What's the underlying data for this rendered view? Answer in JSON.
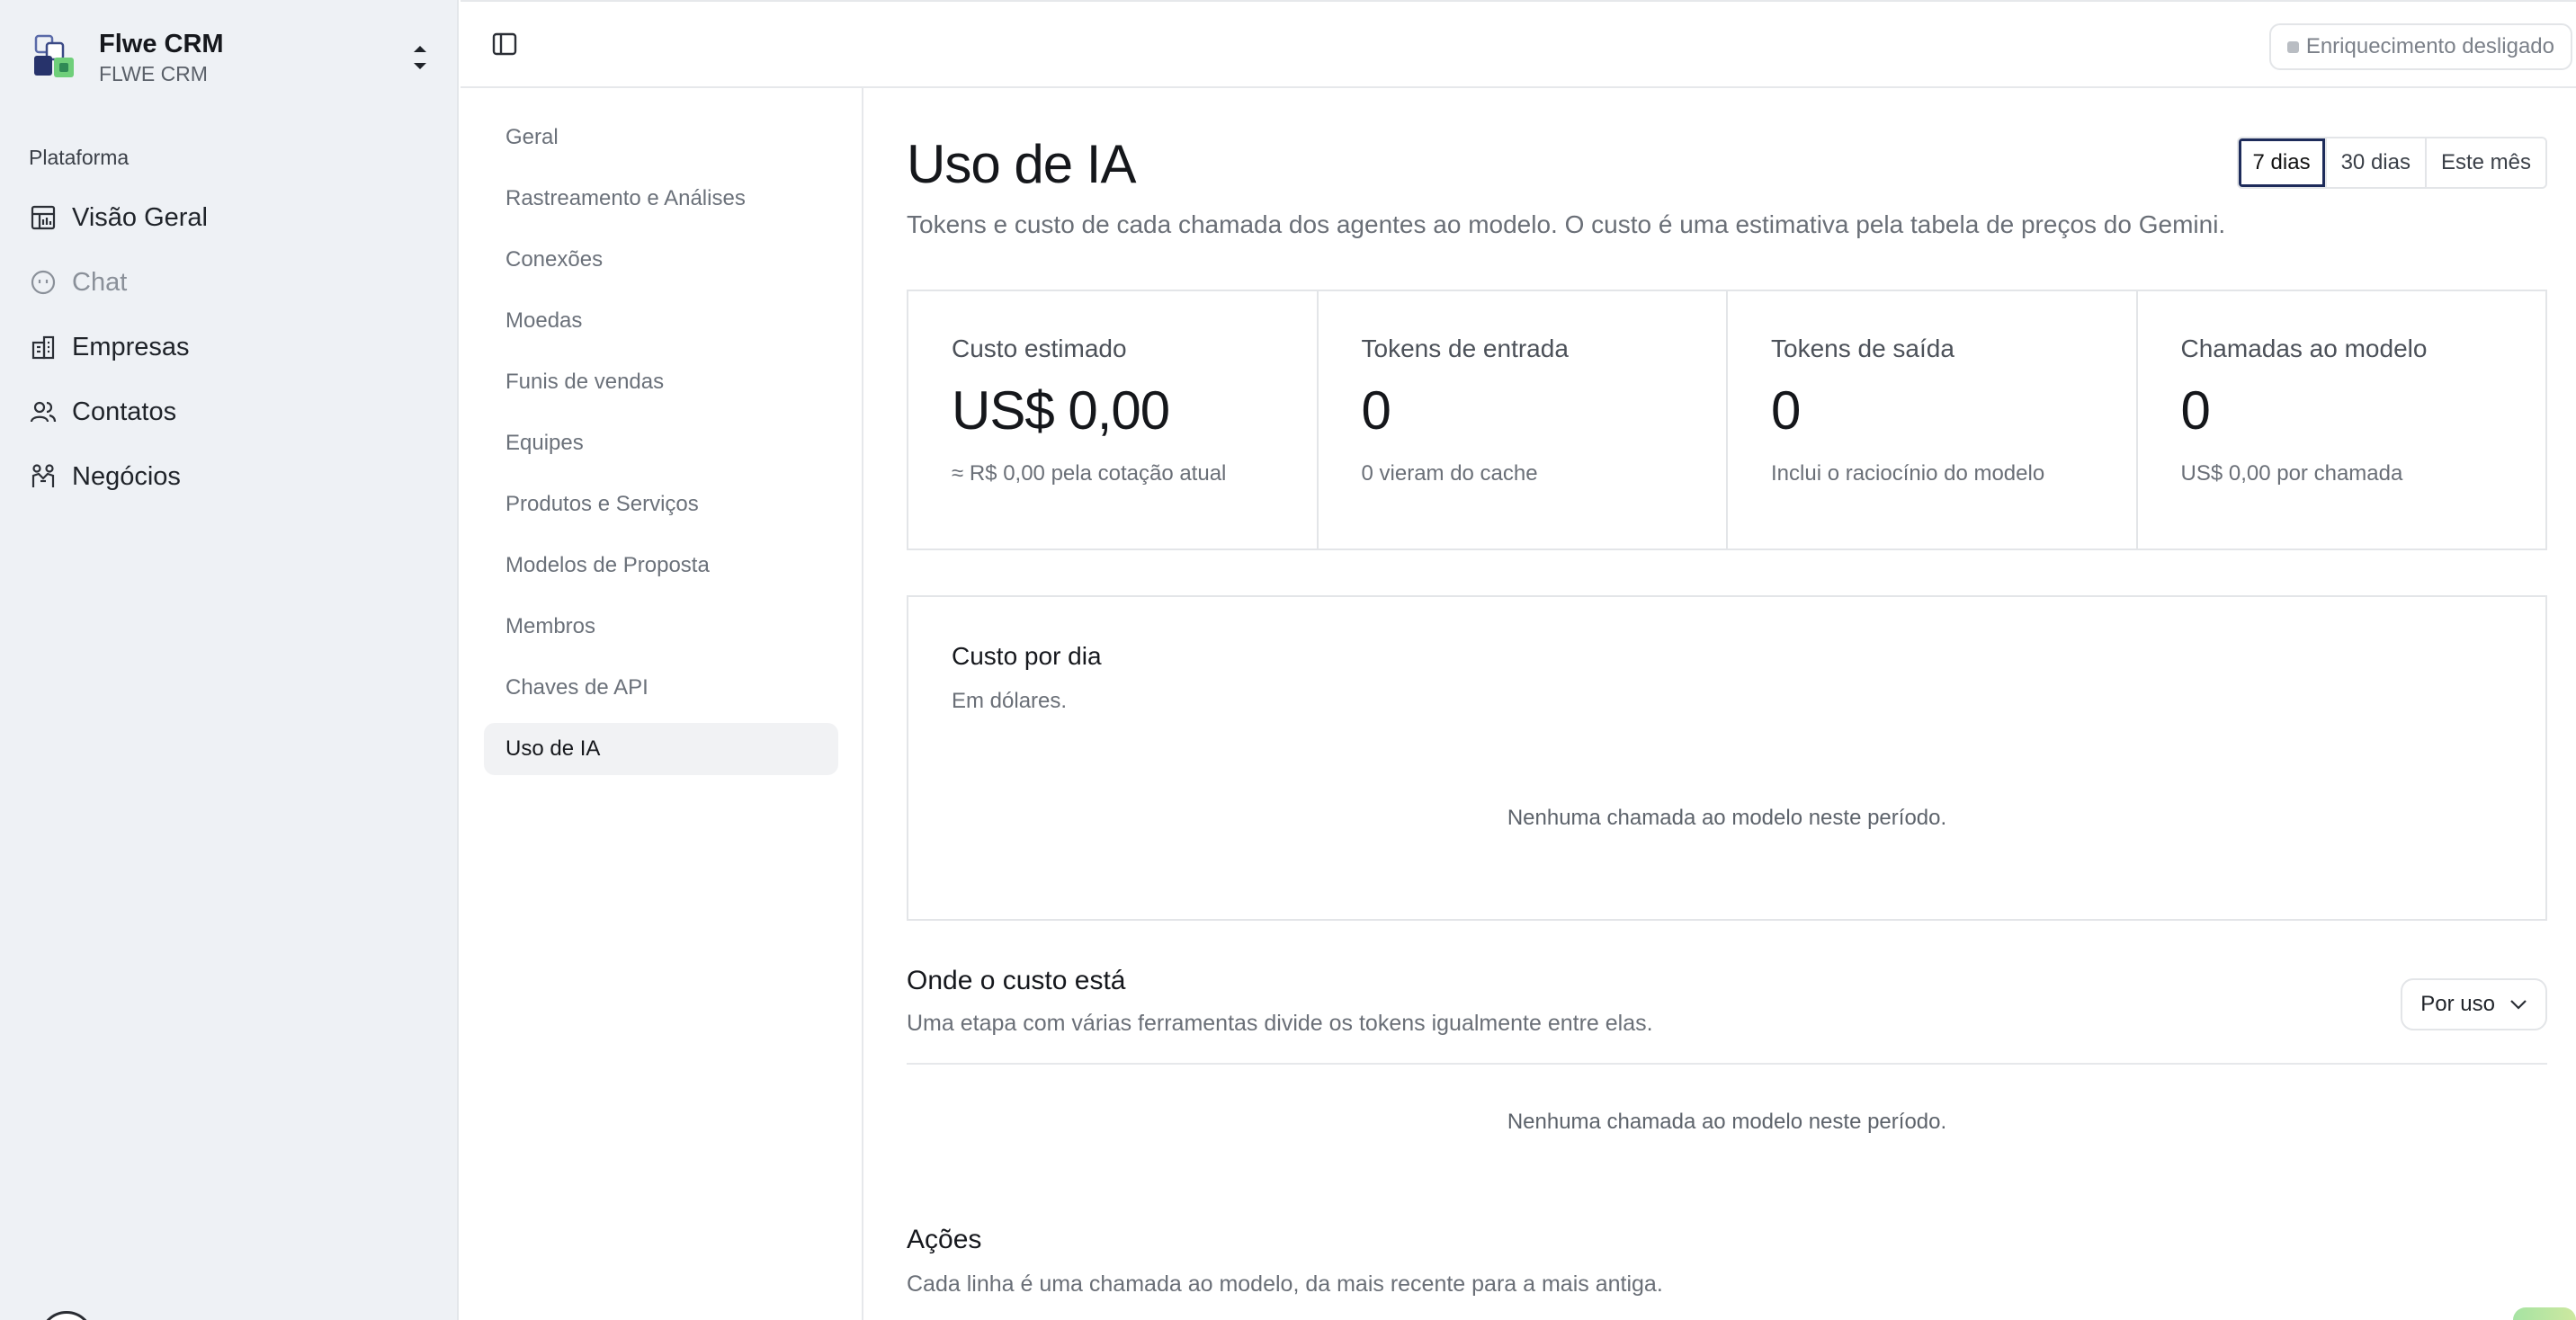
{
  "org": {
    "name": "Flwe CRM",
    "subtitle": "FLWE CRM"
  },
  "sidebar": {
    "section_title": "Plataforma",
    "items": [
      {
        "label": "Visão Geral",
        "icon": "dashboard-icon",
        "disabled": false
      },
      {
        "label": "Chat",
        "icon": "chat-icon",
        "disabled": true
      },
      {
        "label": "Empresas",
        "icon": "building-icon",
        "disabled": false
      },
      {
        "label": "Contatos",
        "icon": "users-icon",
        "disabled": false
      },
      {
        "label": "Negócios",
        "icon": "handshake-icon",
        "disabled": false
      }
    ]
  },
  "topbar": {
    "enrichment_status": "Enriquecimento desligado"
  },
  "settings_nav": {
    "items": [
      "Geral",
      "Rastreamento e Análises",
      "Conexões",
      "Moedas",
      "Funis de vendas",
      "Equipes",
      "Produtos e Serviços",
      "Modelos de Proposta",
      "Membros",
      "Chaves de API",
      "Uso de IA"
    ],
    "active": "Uso de IA"
  },
  "page": {
    "title": "Uso de IA",
    "description": "Tokens e custo de cada chamada dos agentes ao modelo. O custo é uma estimativa pela tabela de preços do Gemini.",
    "ranges": [
      "7 dias",
      "30 dias",
      "Este mês"
    ],
    "selected_range": "7 dias"
  },
  "stats": [
    {
      "label": "Custo estimado",
      "value": "US$ 0,00",
      "note": "≈ R$ 0,00 pela cotação atual"
    },
    {
      "label": "Tokens de entrada",
      "value": "0",
      "note": "0 vieram do cache"
    },
    {
      "label": "Tokens de saída",
      "value": "0",
      "note": "Inclui o raciocínio do modelo"
    },
    {
      "label": "Chamadas ao modelo",
      "value": "0",
      "note": "US$ 0,00 por chamada"
    }
  ],
  "daily_cost": {
    "title": "Custo por dia",
    "subtitle": "Em dólares.",
    "empty": "Nenhuma chamada ao modelo neste período."
  },
  "cost_breakdown": {
    "title": "Onde o custo está",
    "subtitle": "Uma etapa com várias ferramentas divide os tokens igualmente entre elas.",
    "group_by": "Por uso",
    "empty": "Nenhuma chamada ao modelo neste período."
  },
  "actions": {
    "title": "Ações",
    "subtitle": "Cada linha é uma chamada ao modelo, da mais recente para a mais antiga."
  }
}
